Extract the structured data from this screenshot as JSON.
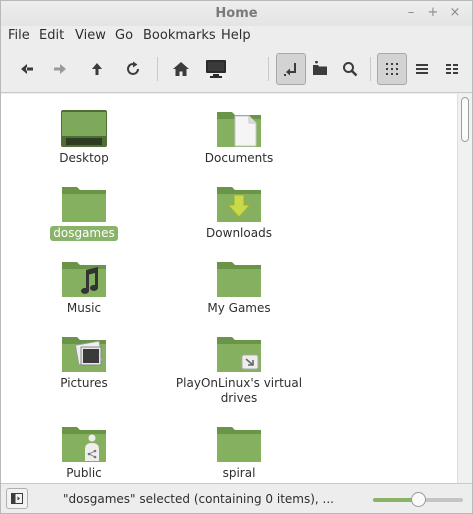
{
  "window": {
    "title": "Home"
  },
  "menu": [
    "File",
    "Edit",
    "View",
    "Go",
    "Bookmarks",
    "Help"
  ],
  "toolbar": {
    "buttons": [
      "back-icon",
      "forward-icon",
      "up-icon",
      "reload-icon",
      "home-icon",
      "computer-icon",
      "location-toggle-icon",
      "new-folder-icon",
      "search-icon",
      "icon-view-icon",
      "list-view-icon",
      "compact-view-icon"
    ]
  },
  "files": [
    {
      "name": "Desktop",
      "type": "desktop"
    },
    {
      "name": "Documents",
      "type": "documents"
    },
    {
      "name": "dosgames",
      "type": "plain",
      "selected": true
    },
    {
      "name": "Downloads",
      "type": "downloads"
    },
    {
      "name": "Music",
      "type": "music"
    },
    {
      "name": "My Games",
      "type": "plain"
    },
    {
      "name": "Pictures",
      "type": "pictures"
    },
    {
      "name": "PlayOnLinux's virtual drives",
      "type": "link"
    },
    {
      "name": "Public",
      "type": "public"
    },
    {
      "name": "spiral",
      "type": "plain"
    }
  ],
  "status": {
    "text": "\"dosgames\" selected (containing 0 items), ...",
    "zoom_level": 0.5
  },
  "colors": {
    "accent": "#8ab36a",
    "folder": "#7fa95a"
  }
}
